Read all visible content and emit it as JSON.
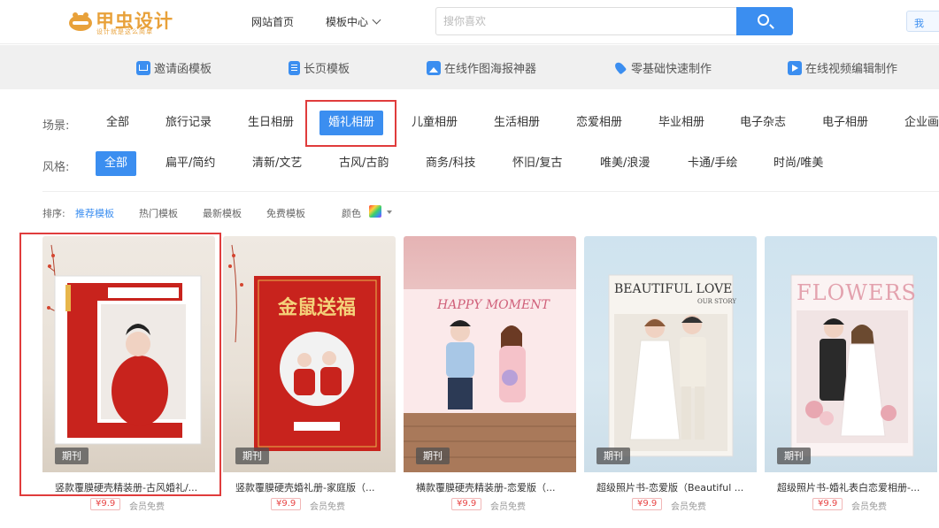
{
  "header": {
    "logo_text": "甲虫设计",
    "logo_sub": "设计就是这么简单",
    "nav_home": "网站首页",
    "nav_templates": "模板中心",
    "search_placeholder": "搜你喜欢",
    "right_button": "我"
  },
  "band": {
    "items": [
      {
        "label": "邀请函模板",
        "icon": "envelope-icon"
      },
      {
        "label": "长页模板",
        "icon": "document-icon"
      },
      {
        "label": "在线作图海报神器",
        "icon": "image-icon"
      },
      {
        "label": "零基础快速制作",
        "icon": "rocket-icon"
      },
      {
        "label": "在线视频编辑制作",
        "icon": "video-icon"
      }
    ]
  },
  "filters": {
    "scene_label": "场景:",
    "scene_items": [
      "全部",
      "旅行记录",
      "生日相册",
      "婚礼相册",
      "儿童相册",
      "生活相册",
      "恋爱相册",
      "毕业相册",
      "电子杂志",
      "电子相册",
      "企业画"
    ],
    "scene_selected": "婚礼相册",
    "style_label": "风格:",
    "style_items": [
      "全部",
      "扁平/简约",
      "清新/文艺",
      "古风/古韵",
      "商务/科技",
      "怀旧/复古",
      "唯美/浪漫",
      "卡通/手绘",
      "时尚/唯美"
    ],
    "style_selected": "全部"
  },
  "sort": {
    "label": "排序:",
    "options": [
      "推荐模板",
      "热门模板",
      "最新模板",
      "免费模板"
    ],
    "selected": "推荐模板",
    "color_label": "颜色"
  },
  "cards": [
    {
      "tag": "期刊",
      "title": "竖款覆膜硬壳精装册-古风婚礼/...",
      "price": "¥9.9",
      "member": "会员免费"
    },
    {
      "tag": "期刊",
      "title": "竖款覆膜硬壳婚礼册-家庭版（...",
      "price": "¥9.9",
      "member": "会员免费"
    },
    {
      "tag": "期刊",
      "title": "横款覆膜硬壳精装册-恋爱版（...",
      "price": "¥9.9",
      "member": "会员免费"
    },
    {
      "tag": "期刊",
      "title": "超级照片书-恋爱版（Beautiful ...",
      "price": "¥9.9",
      "member": "会员免费"
    },
    {
      "tag": "期刊",
      "title": "超级照片书-婚礼表白恋爱相册-...",
      "price": "¥9.9",
      "member": "会员免费"
    }
  ],
  "thumb_text": {
    "card2_title": "金鼠送福",
    "card3_title": "HAPPY MOMENT",
    "card4_title": "BEAUTIFUL LOVE",
    "card4_sub": "OUR STORY",
    "card5_title": "FLOWERS"
  },
  "colors": {
    "accent": "#3b8ef0",
    "highlight": "#e03c3c",
    "price": "#e84646"
  }
}
